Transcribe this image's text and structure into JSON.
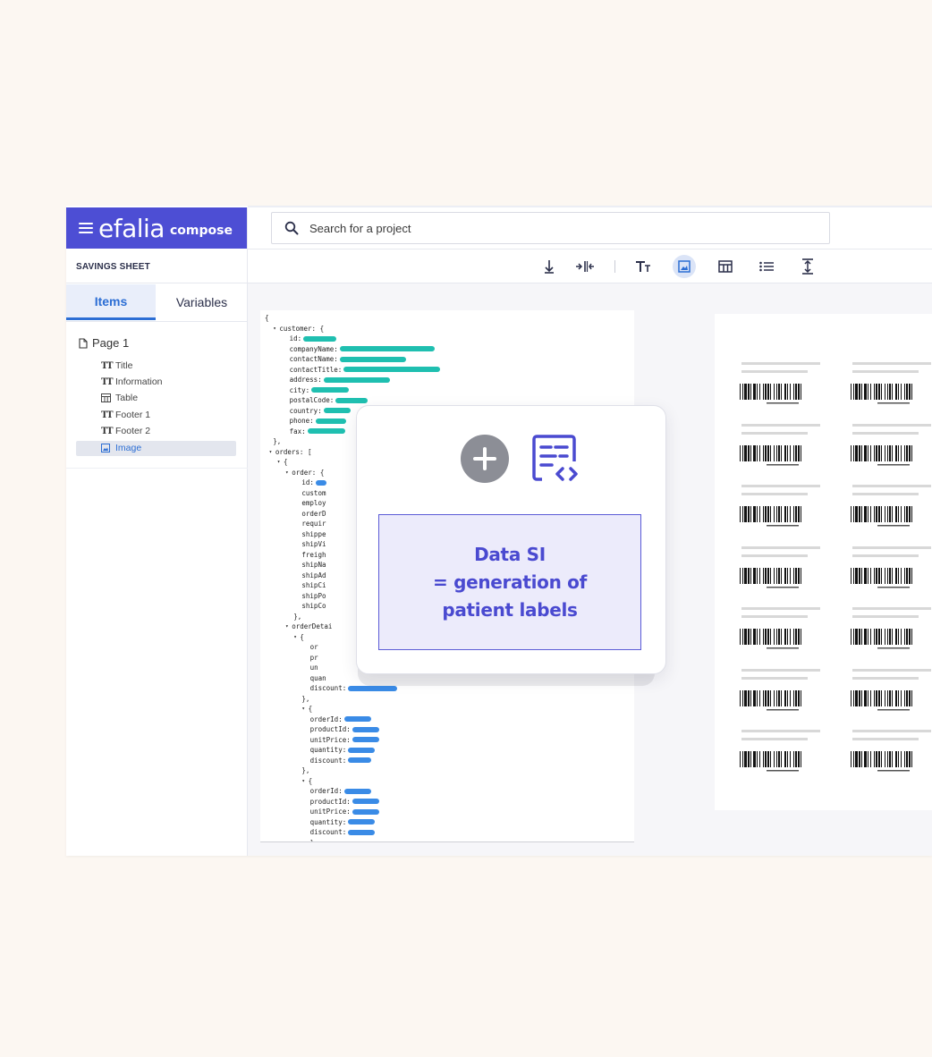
{
  "app": {
    "brand": "efalia",
    "brand_sub": "compose",
    "search_placeholder": "Search for a project",
    "sheet_title": "SAVINGS SHEET"
  },
  "tabs": [
    {
      "label": "Items",
      "active": true
    },
    {
      "label": "Variables",
      "active": false
    }
  ],
  "tree": {
    "page_label": "Page 1",
    "items": [
      {
        "label": "Title",
        "icon": "text-icon"
      },
      {
        "label": "Information",
        "icon": "text-icon"
      },
      {
        "label": "Table",
        "icon": "table-icon"
      },
      {
        "label": "Footer 1",
        "icon": "text-icon"
      },
      {
        "label": "Footer 2",
        "icon": "text-icon"
      },
      {
        "label": "Image",
        "icon": "image-icon",
        "selected": true
      }
    ]
  },
  "toolbar": {
    "icons": [
      "align-bottom-icon",
      "split-columns-icon",
      "text-icon",
      "image-icon",
      "table-icon",
      "list-icon",
      "vertical-spacing-icon"
    ],
    "active": "image-icon"
  },
  "code": {
    "lines": [
      {
        "text": "{"
      },
      {
        "text": "customer: {"
      },
      {
        "text": "id:"
      },
      {
        "text": "companyName:"
      },
      {
        "text": "contactName:"
      },
      {
        "text": "contactTitle:"
      },
      {
        "text": "address:"
      },
      {
        "text": "city:"
      },
      {
        "text": "postalCode:"
      },
      {
        "text": "country:"
      },
      {
        "text": "phone:"
      },
      {
        "text": "fax:"
      },
      {
        "text": "},"
      },
      {
        "text": "orders: ["
      },
      {
        "text": "{"
      },
      {
        "text": "order: {"
      },
      {
        "text": "id:"
      },
      {
        "text": "custom"
      },
      {
        "text": "employ"
      },
      {
        "text": "orderD"
      },
      {
        "text": "requir"
      },
      {
        "text": "shippe"
      },
      {
        "text": "shipVi"
      },
      {
        "text": "freigh"
      },
      {
        "text": "shipNa"
      },
      {
        "text": "shipAd"
      },
      {
        "text": "shipCi"
      },
      {
        "text": "shipPo"
      },
      {
        "text": "shipCo"
      },
      {
        "text": "},"
      },
      {
        "text": "orderDetai"
      },
      {
        "text": "{"
      },
      {
        "text": "or"
      },
      {
        "text": "pr"
      },
      {
        "text": "un"
      },
      {
        "text": "quan"
      },
      {
        "text": "discount:"
      },
      {
        "text": "},"
      },
      {
        "text": "{"
      },
      {
        "text": "orderId:"
      },
      {
        "text": "productId:"
      },
      {
        "text": "unitPrice:"
      },
      {
        "text": "quantity:"
      },
      {
        "text": "discount:"
      },
      {
        "text": "},"
      },
      {
        "text": "{"
      },
      {
        "text": "orderId:"
      },
      {
        "text": "productId:"
      },
      {
        "text": "unitPrice:"
      },
      {
        "text": "quantity:"
      },
      {
        "text": "discount:"
      },
      {
        "text": "}"
      }
    ]
  },
  "callout": {
    "line1": "Data SI",
    "line2": "= generation of",
    "line3": "patient labels"
  },
  "colors": {
    "brand": "#4d4ed4",
    "accent": "#2c6ed4",
    "teal": "#1fbfb0",
    "blue": "#3a8be6",
    "callout_text": "#4a4ad0"
  }
}
